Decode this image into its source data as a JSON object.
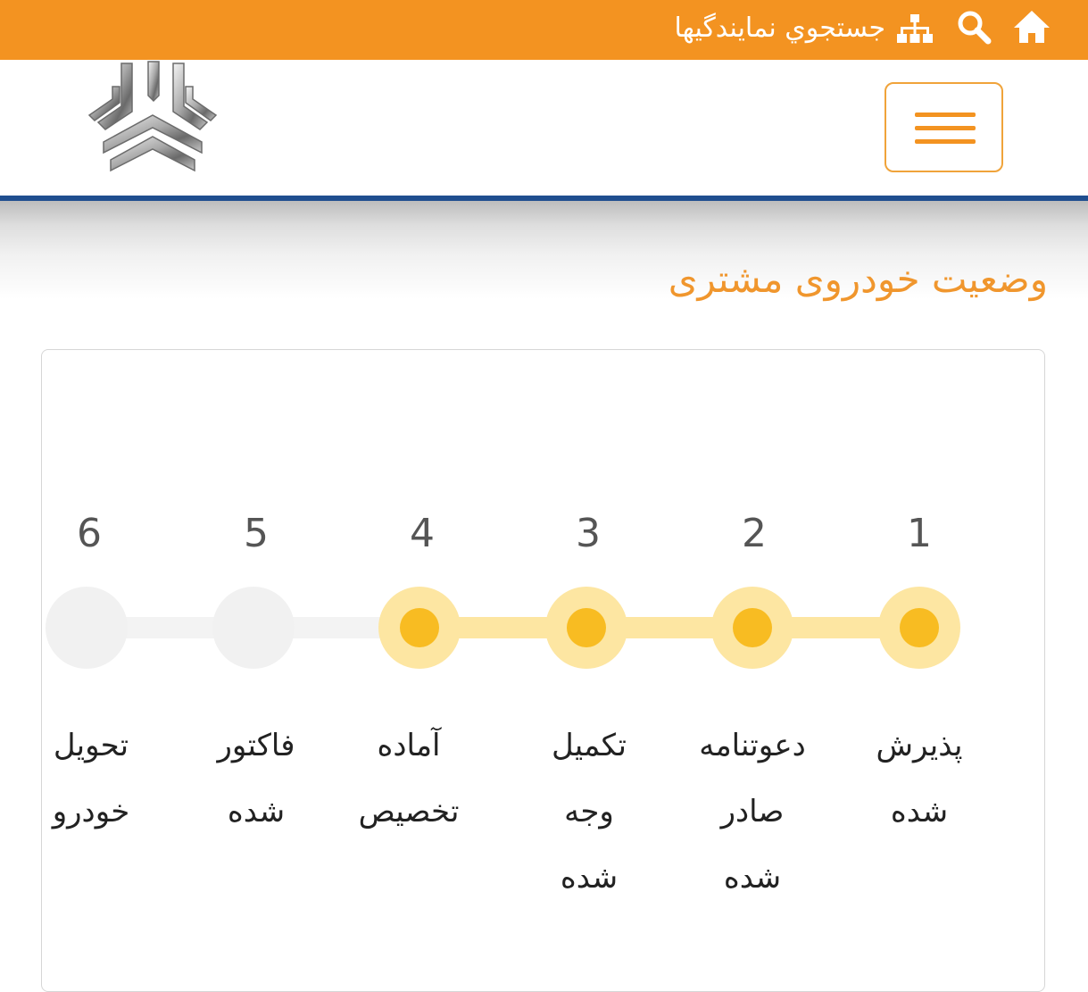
{
  "topbar": {
    "dealer_search_label": "جستجوي نمايندگيها",
    "icons": [
      "home-icon",
      "search-icon",
      "sitemap-icon"
    ],
    "background_color": "#f39321"
  },
  "header": {
    "logo": "saipa-logo",
    "menu_icon": "hamburger-menu-icon"
  },
  "page": {
    "title": "وضعیت خودروی مشتری"
  },
  "status_tracker": {
    "completed_color": "#f8bc22",
    "completed_ring_color": "#fde6a2",
    "pending_color": "#f1f1f1",
    "steps": [
      {
        "number": "1",
        "line1": "پذیرش",
        "line2": "شده",
        "line3": "",
        "completed": true
      },
      {
        "number": "2",
        "line1": "دعوتنامه",
        "line2": "صادر",
        "line3": "شده",
        "completed": true
      },
      {
        "number": "3",
        "line1": "تکمیل",
        "line2": "وجه",
        "line3": "شده",
        "completed": true
      },
      {
        "number": "4",
        "line1": "آماده",
        "line2": "تخصیص",
        "line3": "",
        "completed": true
      },
      {
        "number": "5",
        "line1": "فاکتور",
        "line2": "شده",
        "line3": "",
        "completed": false
      },
      {
        "number": "6",
        "line1": "تحویل",
        "line2": "خودرو",
        "line3": "",
        "completed": false
      }
    ]
  }
}
